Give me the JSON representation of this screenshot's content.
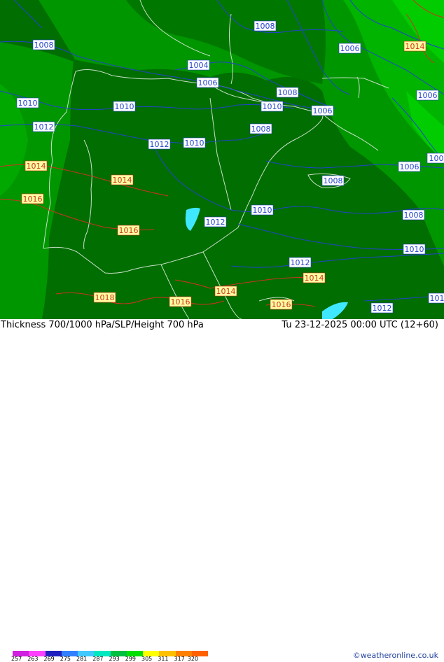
{
  "title": "Thickness 700/1000 hPa/SLP/Height 700 hPa",
  "valid_time": "Tu 23-12-2025 00:00 UTC (12+60)",
  "credit": "©weatheronline.co.uk",
  "legend": {
    "ticks": [
      "257",
      "263",
      "269",
      "275",
      "281",
      "287",
      "293",
      "299",
      "305",
      "311",
      "317",
      "320"
    ],
    "colors": [
      "#d020e0",
      "#ff40ff",
      "#2020c0",
      "#3080ff",
      "#40c8ff",
      "#00e8c0",
      "#00c040",
      "#00e000",
      "#ffff00",
      "#ffc000",
      "#ff8000",
      "#ff6000"
    ]
  },
  "colors": {
    "dark_green": "#006e00",
    "mid_green": "#009600",
    "bright_green": "#00b400",
    "light_green": "#00cc00",
    "cyan": "#40e8ff",
    "isobar_blue": "#2244cc",
    "isobar_red": "#cc3322",
    "coast": "#c8e0c8"
  },
  "isobar_labels": [
    {
      "text": "1008",
      "color": "blue"
    },
    {
      "text": "1006",
      "color": "blue"
    },
    {
      "text": "1014",
      "color": "red"
    },
    {
      "text": "1004",
      "color": "blue"
    },
    {
      "text": "1006",
      "color": "blue"
    },
    {
      "text": "1010",
      "color": "blue"
    },
    {
      "text": "1010",
      "color": "blue"
    },
    {
      "text": "1008",
      "color": "blue"
    },
    {
      "text": "1010",
      "color": "blue"
    },
    {
      "text": "1006",
      "color": "blue"
    },
    {
      "text": "1006",
      "color": "blue"
    },
    {
      "text": "1012",
      "color": "blue"
    },
    {
      "text": "1008",
      "color": "blue"
    },
    {
      "text": "1012",
      "color": "blue"
    },
    {
      "text": "1010",
      "color": "blue"
    },
    {
      "text": "1014",
      "color": "red"
    },
    {
      "text": "1006",
      "color": "blue"
    },
    {
      "text": "1008",
      "color": "blue"
    },
    {
      "text": "1014",
      "color": "red"
    },
    {
      "text": "1016",
      "color": "red"
    },
    {
      "text": "1010",
      "color": "blue"
    },
    {
      "text": "1012",
      "color": "blue"
    },
    {
      "text": "1008",
      "color": "blue"
    },
    {
      "text": "1016",
      "color": "red"
    },
    {
      "text": "1010",
      "color": "blue"
    },
    {
      "text": "1012",
      "color": "blue"
    },
    {
      "text": "1014",
      "color": "red"
    },
    {
      "text": "1018",
      "color": "red"
    },
    {
      "text": "1014",
      "color": "red"
    },
    {
      "text": "1016",
      "color": "red"
    },
    {
      "text": "1016",
      "color": "red"
    },
    {
      "text": "1012",
      "color": "blue"
    },
    {
      "text": "101",
      "color": "blue"
    },
    {
      "text": "100",
      "color": "blue"
    }
  ]
}
